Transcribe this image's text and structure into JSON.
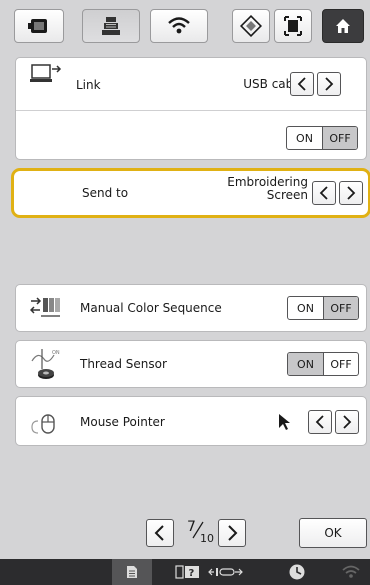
{
  "settings": {
    "link": {
      "label": "Link",
      "value": "USB cable",
      "on_label": "ON",
      "off_label": "OFF",
      "selected": "OFF"
    },
    "send_to": {
      "label": "Send to",
      "value_line1": "Embroidering",
      "value_line2": "Screen"
    },
    "manual_color_sequence": {
      "label": "Manual Color Sequence",
      "on_label": "ON",
      "off_label": "OFF",
      "selected": "OFF"
    },
    "thread_sensor": {
      "label": "Thread Sensor",
      "on_label": "ON",
      "off_label": "OFF",
      "selected": "ON"
    },
    "mouse_pointer": {
      "label": "Mouse Pointer"
    }
  },
  "pager": {
    "current": "7",
    "total": "10"
  },
  "footer": {
    "ok_label": "OK"
  },
  "colors": {
    "highlight": "#e0b114",
    "background": "#d4d4d6",
    "selected_segment": "#c7c7c9"
  }
}
